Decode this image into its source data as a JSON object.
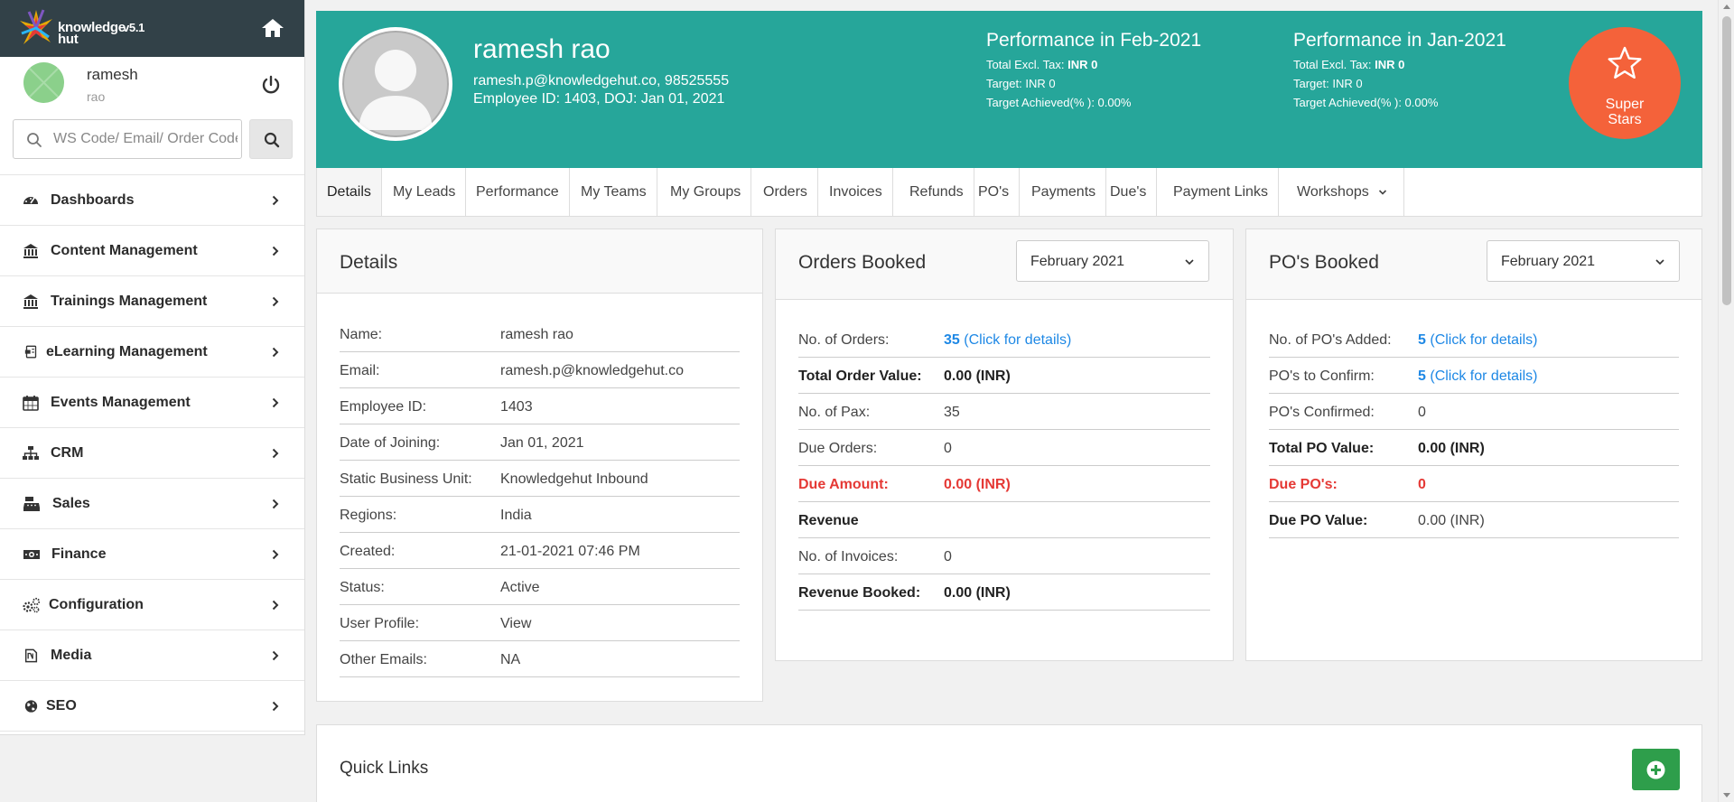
{
  "brand": {
    "name": "knowledge hut",
    "version": "v5.1"
  },
  "user": {
    "first_name": "ramesh",
    "last_name": "rao"
  },
  "search": {
    "placeholder": "WS Code/ Email/ Order Code"
  },
  "sidebar": {
    "items": [
      {
        "label": "Dashboards",
        "icon": "dashboard-icon"
      },
      {
        "label": "Content Management",
        "icon": "bank-icon"
      },
      {
        "label": "Trainings Management",
        "icon": "bank-icon"
      },
      {
        "label": "eLearning Management",
        "icon": "elearning-icon"
      },
      {
        "label": "Events Management",
        "icon": "calendar-icon"
      },
      {
        "label": "CRM",
        "icon": "sitemap-icon"
      },
      {
        "label": "Sales",
        "icon": "cash-register-icon"
      },
      {
        "label": "Finance",
        "icon": "money-bill-icon"
      },
      {
        "label": "Configuration",
        "icon": "cogs-icon"
      },
      {
        "label": "Media",
        "icon": "media-icon"
      },
      {
        "label": "SEO",
        "icon": "globe-icon"
      }
    ]
  },
  "profile": {
    "name": "ramesh rao",
    "contact": "ramesh.p@knowledgehut.co, 98525555",
    "employee_line": "Employee ID: 1403, DOJ: Jan 01, 2021",
    "badge_line1": "Super",
    "badge_line2": "Stars"
  },
  "performance": [
    {
      "title": "Performance in Feb-2021",
      "excl_label": "Total Excl. Tax:",
      "excl_value": "INR 0",
      "target": "Target: INR 0",
      "achieved": "Target Achieved(% ): 0.00%"
    },
    {
      "title": "Performance in Jan-2021",
      "excl_label": "Total Excl. Tax:",
      "excl_value": "INR 0",
      "target": "Target: INR 0",
      "achieved": "Target Achieved(% ): 0.00%"
    }
  ],
  "tabs": [
    "Details",
    "My Leads",
    "Performance",
    "My Teams",
    "My Groups",
    "Orders",
    "Invoices",
    "Refunds",
    "PO's",
    "Payments",
    "Due's",
    "Payment Links",
    "Workshops"
  ],
  "details": {
    "title": "Details",
    "rows": [
      {
        "k": "Name:",
        "v": "ramesh rao"
      },
      {
        "k": "Email:",
        "v": "ramesh.p@knowledgehut.co"
      },
      {
        "k": "Employee ID:",
        "v": "1403"
      },
      {
        "k": "Date of Joining:",
        "v": "Jan 01, 2021"
      },
      {
        "k": "Static Business Unit:",
        "v": "Knowledgehut Inbound"
      },
      {
        "k": "Regions:",
        "v": "India"
      },
      {
        "k": "Created:",
        "v": "21-01-2021 07:46 PM"
      },
      {
        "k": "Status:",
        "v": "Active"
      },
      {
        "k": "User Profile:",
        "v": "View"
      },
      {
        "k": "Other Emails:",
        "v": "NA"
      }
    ]
  },
  "orders": {
    "title": "Orders Booked",
    "month": "February 2021",
    "rows": [
      {
        "k": "No. of Orders:",
        "num": "35",
        "link": "(Click for details)"
      },
      {
        "k": "Total Order Value:",
        "v": "0.00 (INR)"
      },
      {
        "k": "No. of Pax:",
        "v": "35"
      },
      {
        "k": "Due Orders:",
        "v": "0"
      },
      {
        "k": "Due Amount:",
        "v": "0.00 (INR)"
      },
      {
        "k": "Revenue",
        "v": ""
      },
      {
        "k": "No. of Invoices:",
        "v": "0"
      },
      {
        "k": "Revenue Booked:",
        "v": "0.00 (INR)"
      }
    ]
  },
  "pos": {
    "title": "PO's Booked",
    "month": "February 2021",
    "rows": [
      {
        "k": "No. of PO's Added:",
        "num": "5",
        "link": "(Click for details)"
      },
      {
        "k": "PO's to Confirm:",
        "num": "5",
        "link": "(Click for details)"
      },
      {
        "k": "PO's Confirmed:",
        "v": "0"
      },
      {
        "k": "Total PO Value:",
        "v": "0.00 (INR)"
      },
      {
        "k": "Due PO's:",
        "v": "0"
      },
      {
        "k": "Due PO Value:",
        "v": "0.00 (INR)"
      }
    ]
  },
  "quick_links": {
    "title": "Quick Links"
  },
  "colors": {
    "header": "#26a69a",
    "badge": "#f4623a",
    "link": "#1e88e5",
    "danger": "#e53935",
    "add": "#2e9e4b",
    "brand_bar": "#324148"
  }
}
